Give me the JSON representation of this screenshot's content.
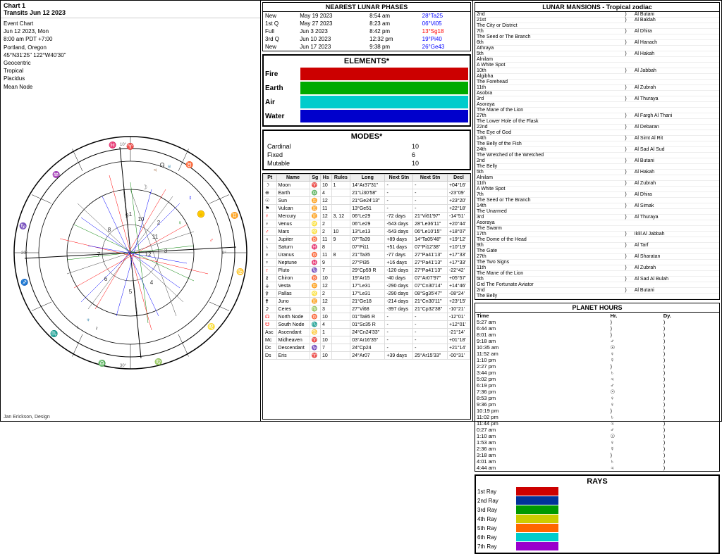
{
  "chart": {
    "title": "Chart 1",
    "subtitle": "Transits Jun 12 2023",
    "type": "Event Chart",
    "date": "Jun 12 2023, Mon",
    "time": "8:00 am  PDT +7:00",
    "location": "Portland, Oregon",
    "coords": "45°N31'25\"  122°W40'30\"",
    "system": "Geocentric",
    "zodiac": "Tropical",
    "house": "Placidus",
    "node": "Mean Node",
    "credit": "Jan Erickson, Design"
  },
  "lunar_phases": {
    "title": "NEAREST LUNAR PHASES",
    "rows": [
      {
        "phase": "New",
        "date": "May 19 2023",
        "time": "8:54 am",
        "degree": "28°Ta25",
        "degree_color": "blue"
      },
      {
        "phase": "1st Q",
        "date": "May 27 2023",
        "time": "8:23 am",
        "degree": "06°Vi05",
        "degree_color": "blue"
      },
      {
        "phase": "Full",
        "date": "Jun 3 2023",
        "time": "8:42 pm",
        "degree": "13°Sg18",
        "degree_color": "red"
      },
      {
        "phase": "3rd Q",
        "date": "Jun 10 2023",
        "time": "12:32 pm",
        "degree": "19°Pi40",
        "degree_color": "blue"
      },
      {
        "phase": "New",
        "date": "Jun 17 2023",
        "time": "9:38 pm",
        "degree": "26°Ge43",
        "degree_color": "blue"
      }
    ]
  },
  "elements": {
    "title": "ELEMENTS*",
    "items": [
      {
        "name": "Fire",
        "color": "#cc0000"
      },
      {
        "name": "Earth",
        "color": "#00aa00"
      },
      {
        "name": "Air",
        "color": "#00cccc"
      },
      {
        "name": "Water",
        "color": "#0000cc"
      }
    ]
  },
  "modes": {
    "title": "MODES*",
    "items": [
      {
        "name": "Cardinal",
        "value": "10"
      },
      {
        "name": "Fixed",
        "value": "6"
      },
      {
        "name": "Mutable",
        "value": "10"
      }
    ]
  },
  "planets": {
    "headers": [
      "Pt",
      "Name",
      "Sg",
      "Hs",
      "Rules",
      "Long",
      "Next Stn",
      "Next Stn",
      "Decl"
    ],
    "rows": [
      {
        "pt": "☽",
        "name": "Moon",
        "sg": "♈",
        "hs": "10",
        "rules": "1",
        "long": "14°Ar37'31\"",
        "stn1": "-",
        "stn2": "-",
        "decl": "+04°16'",
        "color": ""
      },
      {
        "pt": "⊕",
        "name": "Earth",
        "sg": "♎",
        "hs": "4",
        "rules": "",
        "long": "21°Li30'58\"",
        "stn1": "-",
        "stn2": "-",
        "decl": "-23°09'",
        "color": ""
      },
      {
        "pt": "☉",
        "name": "Sun",
        "sg": "♊",
        "hs": "12",
        "rules": "",
        "long": "21°Ge24'13\"",
        "stn1": "-",
        "stn2": "-",
        "decl": "+23°20'",
        "color": ""
      },
      {
        "pt": "⚑",
        "name": "Vulcan",
        "sg": "♊",
        "hs": "11",
        "rules": "",
        "long": "13°Ge51",
        "stn1": "-",
        "stn2": "-",
        "decl": "+22°18'",
        "color": ""
      },
      {
        "pt": "☿",
        "name": "Mercury",
        "sg": "♊",
        "hs": "12",
        "rules": "3, 12",
        "long": "06°Le29",
        "stn1": "-72 days",
        "stn2": "21°Vi61'97\"",
        "decl": "-14°51'",
        "color": "red"
      },
      {
        "pt": "♀",
        "name": "Venus",
        "sg": "♌",
        "hs": "2",
        "rules": "",
        "long": "06°Le29",
        "stn1": "-543 days",
        "stn2": "28°Le36'11\"",
        "decl": "+20°44'",
        "color": ""
      },
      {
        "pt": "♂",
        "name": "Mars",
        "sg": "♌",
        "hs": "2",
        "rules": "10",
        "long": "13°Le13",
        "stn1": "-543 days",
        "stn2": "06°Le10'15\"",
        "decl": "+18°07'",
        "color": "red"
      },
      {
        "pt": "♃",
        "name": "Jupiter",
        "sg": "♉",
        "hs": "11",
        "rules": "9",
        "long": "07°Ta39",
        "stn1": "+89 days",
        "stn2": "14°Ta05'48\"",
        "decl": "+19°12'",
        "color": ""
      },
      {
        "pt": "♄",
        "name": "Saturn",
        "sg": "♓",
        "hs": "8",
        "rules": "",
        "long": "07°Pi11",
        "stn1": "+51 days",
        "stn2": "07°Pi12'38\"",
        "decl": "+10°19'",
        "color": ""
      },
      {
        "pt": "♅",
        "name": "Uranus",
        "sg": "♉",
        "hs": "11",
        "rules": "8",
        "long": "21°Ta35",
        "stn1": "-77 days",
        "stn2": "27°Pa41'13\"",
        "decl": "+17°33'",
        "color": ""
      },
      {
        "pt": "♆",
        "name": "Neptune",
        "sg": "♓",
        "hs": "9",
        "rules": "",
        "long": "27°Pi35",
        "stn1": "+16 days",
        "stn2": "27°Pa41'13\"",
        "decl": "+17°33'",
        "color": ""
      },
      {
        "pt": "♇",
        "name": "Pluto",
        "sg": "♑",
        "hs": "7",
        "rules": "",
        "long": "29°Cp59 R",
        "stn1": "-120 days",
        "stn2": "27°Pa41'13\"",
        "decl": "-22°42'",
        "color": "red"
      },
      {
        "pt": "⚷",
        "name": "Chiron",
        "sg": "♉",
        "hs": "10",
        "rules": "",
        "long": "19°Ar15",
        "stn1": "-40 days",
        "stn2": "07°Ar07'97\"",
        "decl": "+05°57'",
        "color": ""
      },
      {
        "pt": "⚶",
        "name": "Vesta",
        "sg": "♊",
        "hs": "12",
        "rules": "",
        "long": "17°Le31",
        "stn1": "-290 days",
        "stn2": "07°Cn30'14\"",
        "decl": "+14°46'",
        "color": ""
      },
      {
        "pt": "⚴",
        "name": "Pallas",
        "sg": "♌",
        "hs": "2",
        "rules": "",
        "long": "17°Le31",
        "stn1": "-290 days",
        "stn2": "08°Sg35'47\"",
        "decl": "-08°24'",
        "color": ""
      },
      {
        "pt": "⚵",
        "name": "Juno",
        "sg": "♊",
        "hs": "12",
        "rules": "",
        "long": "21°Ge18",
        "stn1": "-214 days",
        "stn2": "21°Cn30'11\"",
        "decl": "+23°15'",
        "color": ""
      },
      {
        "pt": "⚳",
        "name": "Ceres",
        "sg": "♍",
        "hs": "3",
        "rules": "",
        "long": "27°Vi68",
        "stn1": "-397 days",
        "stn2": "21°Cp32'38\"",
        "decl": "-10°21'",
        "color": ""
      },
      {
        "pt": "☊",
        "name": "North Node",
        "sg": "♉",
        "hs": "10",
        "rules": "",
        "long": "01°Ta95 R",
        "stn1": "-",
        "stn2": "-",
        "decl": "-12°01'",
        "color": "red"
      },
      {
        "pt": "☋",
        "name": "South Node",
        "sg": "♏",
        "hs": "4",
        "rules": "",
        "long": "01°Sc35 R",
        "stn1": "-",
        "stn2": "-",
        "decl": "+12°01'",
        "color": "red"
      },
      {
        "pt": "Asc",
        "name": "Ascendant",
        "sg": "♋",
        "hs": "1",
        "rules": "",
        "long": "24°Cn24'33\"",
        "stn1": "-",
        "stn2": "-",
        "decl": "-21°14'",
        "color": ""
      },
      {
        "pt": "Mc",
        "name": "Midheaven",
        "sg": "♈",
        "hs": "10",
        "rules": "",
        "long": "03°Ar16'35\"",
        "stn1": "-",
        "stn2": "-",
        "decl": "+01°18'",
        "color": ""
      },
      {
        "pt": "Dc",
        "name": "Descendant",
        "sg": "♑",
        "hs": "7",
        "rules": "",
        "long": "24°Cp24",
        "stn1": "-",
        "stn2": "-",
        "decl": "+21°14'",
        "color": ""
      },
      {
        "pt": "Ds",
        "name": "Eris",
        "sg": "♈",
        "hs": "10",
        "rules": "",
        "long": "24°Ar07",
        "stn1": "+39 days",
        "stn2": "25°Ar15'33\"",
        "decl": "-00°31'",
        "color": ""
      }
    ]
  },
  "planet_hours": {
    "title": "PLANET HOURS",
    "col_headers": [
      "Time",
      "Hr.",
      "Dy."
    ],
    "rows": [
      {
        "time": "5:27 am",
        "hr": ")",
        "dy": ")"
      },
      {
        "time": "6:44 am",
        "hr": ")",
        "dy": ")"
      },
      {
        "time": "8:01 am",
        "hr": ")",
        "dy": ")"
      },
      {
        "time": "9:18 am",
        "hr": "♂",
        "dy": ")"
      },
      {
        "time": "10:35 am",
        "hr": "☉",
        "dy": ")"
      },
      {
        "time": "11:52 am",
        "hr": "♀",
        "dy": ")"
      },
      {
        "time": "1:10 pm",
        "hr": "☿",
        "dy": ")"
      },
      {
        "time": "2:27 pm",
        "hr": ")",
        "dy": ")"
      },
      {
        "time": "3:44 pm",
        "hr": "♄",
        "dy": ")"
      },
      {
        "time": "5:02 pm",
        "hr": "♃",
        "dy": ")"
      },
      {
        "time": "6:19 pm",
        "hr": "♂",
        "dy": ")"
      },
      {
        "time": "7:36 pm",
        "hr": "☉",
        "dy": ")"
      },
      {
        "time": "8:53 pm",
        "hr": "♀",
        "dy": ")"
      },
      {
        "time": "9:36 pm",
        "hr": "♀",
        "dy": ")"
      },
      {
        "time": "10:19 pm",
        "hr": ")",
        "dy": ")"
      },
      {
        "time": "11:02 pm",
        "hr": "♄",
        "dy": ")"
      },
      {
        "time": "11:44 pm",
        "hr": "♃",
        "dy": ")"
      },
      {
        "time": "0:27 am",
        "hr": "♂",
        "dy": ")"
      },
      {
        "time": "1:10 am",
        "hr": "☉",
        "dy": ")"
      },
      {
        "time": "1:53 am",
        "hr": "♀",
        "dy": ")"
      },
      {
        "time": "2:36 am",
        "hr": "☿",
        "dy": ")"
      },
      {
        "time": "3:18 am",
        "hr": ")",
        "dy": ")"
      },
      {
        "time": "4:01 am",
        "hr": "♄",
        "dy": ")"
      },
      {
        "time": "4:44 am",
        "hr": "♃",
        "dy": ")"
      }
    ]
  },
  "lunar_mansions": {
    "title": "LUNAR MANSIONS - Tropical zodiac",
    "rows": [
      {
        "num": "2nd",
        "symbol": ")",
        "name": "Al Butani"
      },
      {
        "num": "21st",
        "symbol": ")",
        "name": "Al Baldah"
      },
      {
        "num": "The City or District",
        "symbol": "",
        "name": ""
      },
      {
        "num": "7th",
        "symbol": ")",
        "name": "Al Dhira"
      },
      {
        "num": "The Seed or The Branch",
        "symbol": "",
        "name": ""
      },
      {
        "num": "6th",
        "symbol": ")",
        "name": "Al Hanach"
      },
      {
        "num": "Athraya",
        "symbol": "",
        "name": ""
      },
      {
        "num": "5th",
        "symbol": ")",
        "name": "Al Hakah"
      },
      {
        "num": "Alnilam",
        "symbol": "",
        "name": ""
      },
      {
        "num": "A White Spot",
        "symbol": "",
        "name": ""
      },
      {
        "num": "10th",
        "symbol": ")",
        "name": "Al Jabbah"
      },
      {
        "num": "Algibha",
        "symbol": "",
        "name": ""
      },
      {
        "num": "The Forehead",
        "symbol": "",
        "name": ""
      },
      {
        "num": "11th",
        "symbol": ")",
        "name": "Al Zubrah"
      },
      {
        "num": "Asobra",
        "symbol": "",
        "name": ""
      },
      {
        "num": "3rd",
        "symbol": ")",
        "name": "Al Thuraya"
      },
      {
        "num": "Asoraya",
        "symbol": "",
        "name": ""
      },
      {
        "num": "The Mane of the Lion",
        "symbol": "",
        "name": ""
      },
      {
        "num": "27th",
        "symbol": ")",
        "name": "Al Fargh Al Thani"
      },
      {
        "num": "The Lower Hole of the Flask",
        "symbol": "",
        "name": ""
      },
      {
        "num": "22nd",
        "symbol": ")",
        "name": "Al Debaran"
      },
      {
        "num": "The Eye of God",
        "symbol": "",
        "name": ""
      },
      {
        "num": "14th",
        "symbol": ")",
        "name": "Al Simt Al Rit"
      },
      {
        "num": "The Belly of the Fish",
        "symbol": "",
        "name": ""
      },
      {
        "num": "24th",
        "symbol": ")",
        "name": "Al Sad Al Sud"
      },
      {
        "num": "The Wretched of the Wretched",
        "symbol": "",
        "name": ""
      },
      {
        "num": "2nd",
        "symbol": ")",
        "name": "Al Butani"
      },
      {
        "num": "The Belly",
        "symbol": "",
        "name": ""
      },
      {
        "num": "5th",
        "symbol": ")",
        "name": "Al Hakah"
      },
      {
        "num": "Alnilam",
        "symbol": "",
        "name": ""
      },
      {
        "num": "11th",
        "symbol": ")",
        "name": "Al Zubrah"
      },
      {
        "num": "A White Spot",
        "symbol": "",
        "name": ""
      },
      {
        "num": "7th",
        "symbol": ")",
        "name": "Al Dhira"
      },
      {
        "num": "The Seed or The Branch",
        "symbol": "",
        "name": ""
      },
      {
        "num": "14th",
        "symbol": ")",
        "name": "Al Simak"
      },
      {
        "num": "The Unarmed",
        "symbol": "",
        "name": ""
      },
      {
        "num": "3rd",
        "symbol": ")",
        "name": "Al Thuraya"
      },
      {
        "num": "Asoraya",
        "symbol": "",
        "name": ""
      },
      {
        "num": "The Swarm",
        "symbol": "",
        "name": ""
      },
      {
        "num": "17th",
        "symbol": ")",
        "name": "Iklil Al Jabbah"
      },
      {
        "num": "The Dome of the Head",
        "symbol": "",
        "name": ""
      },
      {
        "num": "9th",
        "symbol": ")",
        "name": "Al Tarf"
      },
      {
        "num": "The Gate",
        "symbol": "",
        "name": ""
      },
      {
        "num": "27th",
        "symbol": ")",
        "name": "Al Sharatan"
      },
      {
        "num": "The Two Signs",
        "symbol": "",
        "name": ""
      },
      {
        "num": "11th",
        "symbol": ")",
        "name": "Al Zubrah"
      },
      {
        "num": "The Mane of the Lion",
        "symbol": "",
        "name": ""
      },
      {
        "num": "5th",
        "symbol": ")",
        "name": "Al Sad Al Bulah"
      },
      {
        "num": "Grd The Fortunate Aviator",
        "symbol": "",
        "name": ""
      },
      {
        "num": "2nd",
        "symbol": ")",
        "name": "Al Butani"
      },
      {
        "num": "The Belly",
        "symbol": "",
        "name": ""
      }
    ]
  },
  "rays": {
    "title": "RAYS",
    "items": [
      {
        "label": "1st Ray",
        "color": "#cc0000"
      },
      {
        "label": "2nd Ray",
        "color": "#003399"
      },
      {
        "label": "3rd Ray",
        "color": "#009900"
      },
      {
        "label": "4th Ray",
        "color": "#cccc00"
      },
      {
        "label": "5th Ray",
        "color": "#ff6600"
      },
      {
        "label": "6th Ray",
        "color": "#00cccc"
      },
      {
        "label": "7th Ray",
        "color": "#9900cc"
      }
    ]
  }
}
